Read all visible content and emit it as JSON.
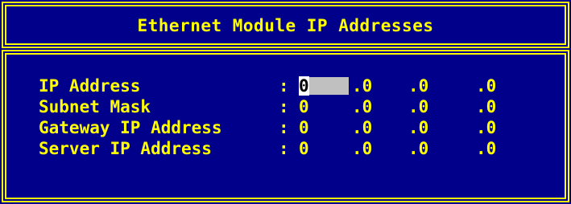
{
  "window": {
    "title": "Ethernet Module IP Addresses"
  },
  "fields": [
    {
      "label": "IP Address",
      "colon": ":",
      "octets": [
        "0",
        ".0",
        ".0",
        ".0"
      ]
    },
    {
      "label": "Subnet Mask",
      "colon": ":",
      "octets": [
        "0",
        ".0",
        ".0",
        ".0"
      ]
    },
    {
      "label": "Gateway IP Address",
      "colon": ":",
      "octets": [
        "0",
        ".0",
        ".0",
        ".0"
      ]
    },
    {
      "label": "Server IP Address",
      "colon": ":",
      "octets": [
        "0",
        ".0",
        ".0",
        ".0"
      ]
    }
  ],
  "colors": {
    "background": "#00008b",
    "text": "#ffff00",
    "border": "#ffff00",
    "selection": "#c0c0c0"
  }
}
